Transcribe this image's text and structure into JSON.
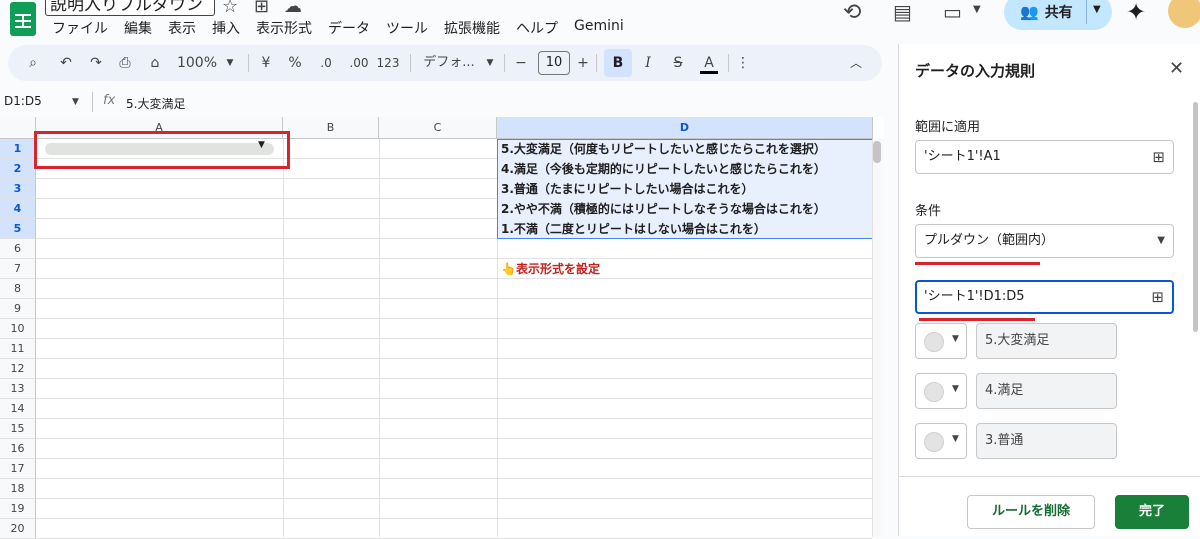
{
  "titlebar": {
    "doc_title": "説明入りプルダウン",
    "menu": [
      "ファイル",
      "編集",
      "表示",
      "挿入",
      "表示形式",
      "データ",
      "ツール",
      "拡張機能",
      "ヘルプ",
      "Gemini"
    ],
    "share_label": "共有"
  },
  "toolbar": {
    "zoom": "100%",
    "currency": "¥",
    "percent": "%",
    "decimal_decrease": ".0",
    "decimal_increase": ".00",
    "format_123": "123",
    "font_name": "デフォ...",
    "font_size": "10",
    "bold": "B",
    "italic": "I",
    "strike": "S",
    "text_color": "A"
  },
  "formula_bar": {
    "namebox": "D1:D5",
    "fx": "fx",
    "content": "5.大変満足"
  },
  "grid": {
    "columns": [
      "A",
      "B",
      "C",
      "D"
    ],
    "rows": [
      "1",
      "2",
      "3",
      "4",
      "5",
      "6",
      "7",
      "8",
      "9",
      "10",
      "11",
      "12",
      "13",
      "14",
      "15",
      "16",
      "17",
      "18",
      "19",
      "20"
    ],
    "d_cells": [
      "5.大変満足（何度もリピートしたいと感じたらこれを選択）",
      "4.満足（今後も定期的にリピートしたいと感じたらこれを）",
      "3.普通（たまにリピートしたい場合はこれを）",
      "2.やや不満（積極的にはリピートしなそうな場合はこれを）",
      "1.不満（二度とリピートはしない場合はこれを）"
    ],
    "d7_text": "👆表示形式を設定"
  },
  "panel": {
    "title": "データの入力規則",
    "range_label": "範囲に適用",
    "range_value": "'シート1'!A1",
    "criteria_label": "条件",
    "criteria_value": "プルダウン（範囲内）",
    "source_range": "'シート1'!D1:D5",
    "chips": [
      "5.大変満足",
      "4.満足",
      "3.普通"
    ],
    "delete_rule": "ルールを削除",
    "done": "完了"
  },
  "colors": {
    "accent_blue": "#0b57d0",
    "highlight_red": "#d9242d",
    "done_green": "#188038"
  }
}
